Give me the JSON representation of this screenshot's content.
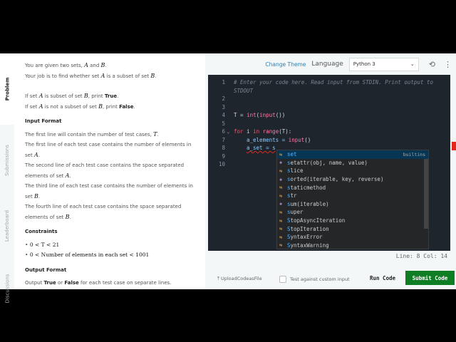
{
  "tabs": [
    "Problem",
    "Submissions",
    "Leaderboard",
    "Discussions"
  ],
  "problem": {
    "l1": [
      "You are given two sets, ",
      "A",
      " and ",
      "B",
      "."
    ],
    "l2": [
      "Your job is to find whether set ",
      "A",
      " is a subset of set ",
      "B",
      "."
    ],
    "l3": [
      "If set ",
      "A",
      " is subset of set ",
      "B",
      ", print ",
      "True",
      "."
    ],
    "l4": [
      "If set ",
      "A",
      " is not a subset of set ",
      "B",
      ", print ",
      "False",
      "."
    ],
    "input_heading": "Input Format",
    "i1": [
      "The first line will contain the number of test cases, ",
      "T",
      "."
    ],
    "i2": [
      "The first line of each test case contains the number of elements in set ",
      "A",
      "."
    ],
    "i3": [
      "The second line of each test case contains the space separated elements of set ",
      "A",
      "."
    ],
    "i4": [
      "The third line of each test case contains the number of elements in set ",
      "B",
      "."
    ],
    "i5": [
      "The fourth line of each test case contains the space separated elements of set ",
      "B",
      "."
    ],
    "constraints_heading": "Constraints",
    "c1": "0 < T < 21",
    "c2": "0 < Number of elements in each set < 1001",
    "output_heading": "Output Format",
    "o1": [
      "Output ",
      "True",
      " or ",
      "False",
      " for each test case on separate lines."
    ]
  },
  "toolbar": {
    "change_theme": "Change Theme",
    "language_label": "Language",
    "language": "Python 3"
  },
  "editor": {
    "line_numbers": [
      "1",
      "",
      "2",
      "3",
      "4",
      "5",
      "6",
      "7",
      "8",
      "9",
      "10"
    ],
    "comment1": "# Enter your code here. Read input from STDIN. Print output to",
    "comment2": "STDOUT",
    "l4a": "T = ",
    "l4b": "int",
    "l4c": "(",
    "l4d": "input",
    "l4e": "())",
    "l6a": "for",
    " l6b": " i ",
    "l6c": "in",
    " l6d": " ",
    "l6e": "range",
    "l6f": "(T):",
    "l7a": "a_elements = ",
    "l7b": "input",
    "l7c": "()",
    "l8": "a_set = s"
  },
  "suggestions": [
    {
      "m": "s",
      "r": "et",
      "src": "builtins",
      "kind": "class"
    },
    {
      "m": "s",
      "r": "etattr(obj, name, value)",
      "kind": "func"
    },
    {
      "m": "s",
      "r": "lice",
      "kind": "class"
    },
    {
      "m": "s",
      "r": "orted(iterable, key, reverse)",
      "kind": "func"
    },
    {
      "m": "s",
      "r": "taticmethod",
      "kind": "class"
    },
    {
      "m": "s",
      "r": "tr",
      "kind": "class"
    },
    {
      "m": "s",
      "r": "um(iterable)",
      "kind": "func"
    },
    {
      "m": "s",
      "r": "uper",
      "kind": "class"
    },
    {
      "m": "S",
      "r": "topAsyncIteration",
      "kind": "class"
    },
    {
      "m": "S",
      "r": "topIteration",
      "kind": "class"
    },
    {
      "m": "S",
      "r": "yntaxError",
      "kind": "class"
    },
    {
      "m": "S",
      "r": "yntaxWarning",
      "kind": "class"
    }
  ],
  "status": "Line: 8 Col: 14",
  "bottom": {
    "upload": "UploadCodeasFile",
    "custom_input": "Test against custom input",
    "run": "Run Code",
    "submit": "Submit Code"
  },
  "colors": {
    "submit": "#0f7d24",
    "editor_bg": "#1e252c",
    "link": "#2b7fb8"
  }
}
